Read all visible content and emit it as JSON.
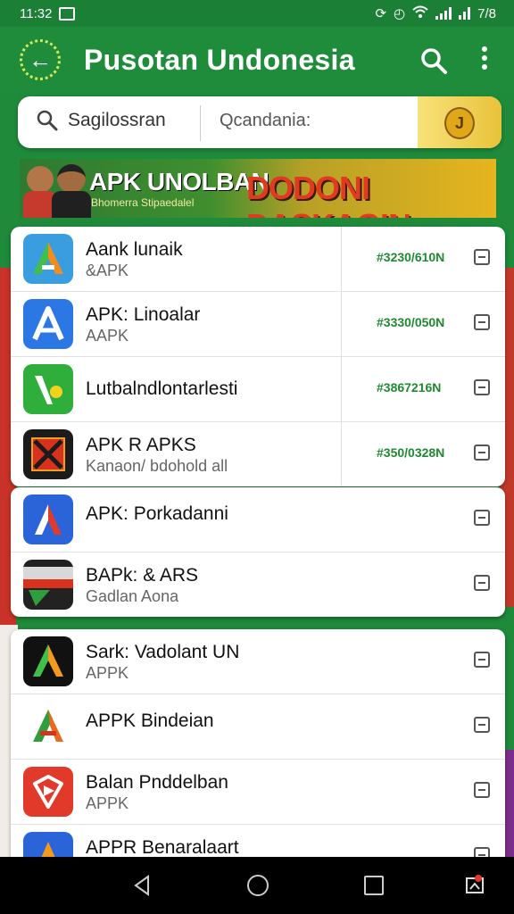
{
  "status_bar": {
    "time": "11:32",
    "right_text": "7/8"
  },
  "app_bar": {
    "title": "Pusotan Undonesia"
  },
  "search": {
    "left_text": "Sagilossran",
    "right_placeholder": "Qcandania:",
    "badge_text": "J"
  },
  "banner": {
    "title_left": "APK UNOLBAN",
    "subtitle_left": "Bhomerra Stipaedalel",
    "title_right": "DODONI DASKAGIN"
  },
  "cards": [
    {
      "rows": [
        {
          "title": "Aank lunaik",
          "sub": "&APK",
          "price": "#3230/610N",
          "icon": "a-logo-orange-green"
        },
        {
          "title": "APK: Linoalar",
          "sub": "AAPK",
          "price": "#3330/050N",
          "icon": "a-logo-blue"
        },
        {
          "title": "Lutbalndlontarlesti",
          "sub": "",
          "price": "#3867216N",
          "icon": "check-logo-green"
        },
        {
          "title": "APK R APKS",
          "sub": "Kanaon/ bdohold all",
          "price": "#350/0328N",
          "icon": "x-logo-red"
        }
      ]
    },
    {
      "rows": [
        {
          "title": "APK: Porkadanni",
          "sub": "",
          "icon": "a-logo-blue-red"
        },
        {
          "title": "BAPk: & ARS",
          "sub": "Gadlan Aona",
          "icon": "flag-logo"
        }
      ]
    },
    {
      "rows": [
        {
          "title": "Sark: Vadolant UN",
          "sub": "APPK",
          "icon": "a-logo-dark"
        },
        {
          "title": "APPK Bindeian",
          "sub": "",
          "icon": "a-logo-tricolor"
        },
        {
          "title": "Balan Pnddelban",
          "sub": "APPK",
          "icon": "play-logo-red"
        },
        {
          "title": "APPR Benaralaart",
          "sub": "",
          "icon": "a-logo-blue-orange"
        }
      ]
    }
  ],
  "colors": {
    "primary": "#1f8c3c",
    "price": "#1d8a2f",
    "accent_gold": "#e9c23a"
  }
}
